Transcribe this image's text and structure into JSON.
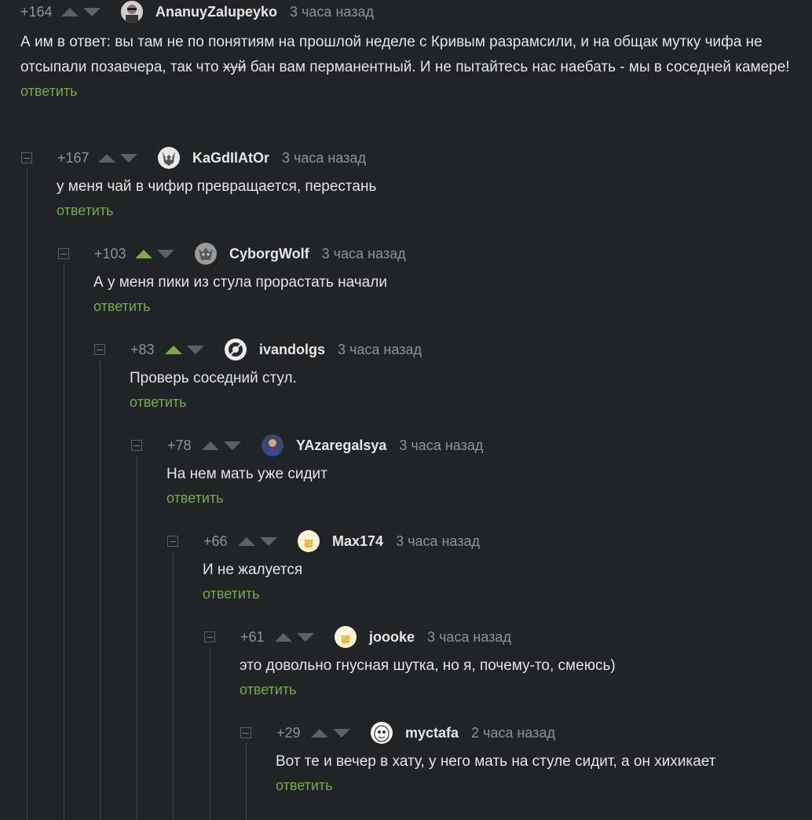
{
  "colors": {
    "background": "#212427",
    "text": "#e3e3e3",
    "muted": "#8d9297",
    "reply": "#7aa84a",
    "vote_active": "#7aa84a",
    "vote_inactive": "#5d6166"
  },
  "reply_label": "ответить",
  "comments": [
    {
      "rating": "+164",
      "username": "AnanuyZalupeyko",
      "time": "3 часа назад",
      "text_before": "А им в ответ: вы там не по понятиям на прошлой неделе с Кривым разрамсили, и на общак мутку чифа не отсыпали позавчера, так что ",
      "text_struck": "хуй",
      "text_after": " бан вам перманентный. И не пытайтесь нас наебать - мы в соседней камере!",
      "upvoted": false
    },
    {
      "rating": "+167",
      "username": "KaGdIlAtOr",
      "time": "3 часа назад",
      "text": "у меня чай в чифир превращается, перестань",
      "upvoted": false
    },
    {
      "rating": "+103",
      "username": "CyborgWolf",
      "time": "3 часа назад",
      "text": "А у меня пики из стула прорастать начали",
      "upvoted": true
    },
    {
      "rating": "+83",
      "username": "ivandolgs",
      "time": "3 часа назад",
      "text": "Проверь соседний стул.",
      "upvoted": true
    },
    {
      "rating": "+78",
      "username": "YAzaregalsya",
      "time": "3 часа назад",
      "text": "На нем мать уже сидит",
      "upvoted": false
    },
    {
      "rating": "+66",
      "username": "Max174",
      "time": "3 часа назад",
      "text": "И не жалуется",
      "upvoted": false
    },
    {
      "rating": "+61",
      "username": "joooke",
      "time": "3 часа назад",
      "text": "это довольно гнусная шутка, но я, почему-то, смеюсь)",
      "upvoted": false
    },
    {
      "rating": "+29",
      "username": "myctafa",
      "time": "2 часа назад",
      "text": "Вот те и вечер в хату, у него мать на стуле сидит, а он хихикает",
      "upvoted": false
    }
  ]
}
